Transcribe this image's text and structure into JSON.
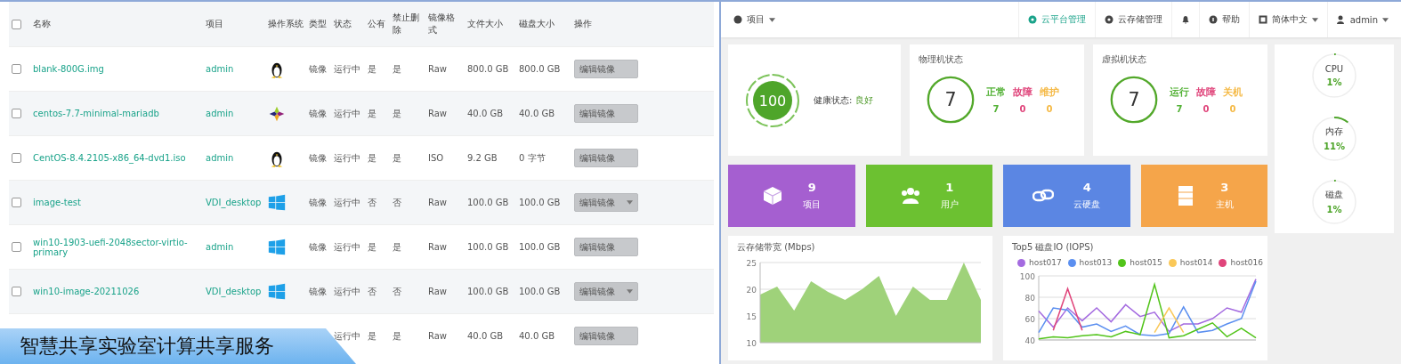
{
  "image_table": {
    "columns": [
      "名称",
      "项目",
      "操作系统",
      "类型",
      "状态",
      "公有",
      "禁止删除",
      "镜像格式",
      "文件大小",
      "磁盘大小",
      "操作"
    ],
    "header_checkbox": {
      "checked": false
    },
    "rows": [
      {
        "checked": false,
        "name": "blank-800G.img",
        "project": "admin",
        "kind": "linux",
        "type": "镜像",
        "status": "运行中",
        "public": "是",
        "protected": "是",
        "format": "Raw",
        "file_size": "800.0 GB",
        "disk_size": "800.0 GB",
        "action": "编辑镜像",
        "has_menu": false
      },
      {
        "checked": false,
        "name": "centos-7.7-minimal-mariadb",
        "project": "admin",
        "kind": "centos",
        "type": "镜像",
        "status": "运行中",
        "public": "是",
        "protected": "是",
        "format": "Raw",
        "file_size": "40.0 GB",
        "disk_size": "40.0 GB",
        "action": "编辑镜像",
        "has_menu": false
      },
      {
        "checked": false,
        "name": "CentOS-8.4.2105-x86_64-dvd1.iso",
        "project": "admin",
        "kind": "linux",
        "type": "镜像",
        "status": "运行中",
        "public": "是",
        "protected": "是",
        "format": "ISO",
        "file_size": "9.2 GB",
        "disk_size": "0 字节",
        "action": "编辑镜像",
        "has_menu": false
      },
      {
        "checked": false,
        "name": "image-test",
        "project": "VDI_desktop",
        "kind": "windows",
        "type": "镜像",
        "status": "运行中",
        "public": "否",
        "protected": "否",
        "format": "Raw",
        "file_size": "100.0 GB",
        "disk_size": "100.0 GB",
        "action": "编辑镜像",
        "has_menu": true
      },
      {
        "checked": false,
        "name": "win10-1903-uefi-2048sector-virtio-primary",
        "project": "admin",
        "kind": "windows",
        "type": "镜像",
        "status": "运行中",
        "public": "是",
        "protected": "是",
        "format": "Raw",
        "file_size": "100.0 GB",
        "disk_size": "100.0 GB",
        "action": "编辑镜像",
        "has_menu": false
      },
      {
        "checked": false,
        "name": "win10-image-20211026",
        "project": "VDI_desktop",
        "kind": "windows",
        "type": "镜像",
        "status": "运行中",
        "public": "否",
        "protected": "否",
        "format": "Raw",
        "file_size": "100.0 GB",
        "disk_size": "100.0 GB",
        "action": "编辑镜像",
        "has_menu": true
      },
      {
        "status": "运行中",
        "public": "是",
        "protected": "是",
        "format": "Raw",
        "file_size": "40.0 GB",
        "disk_size": "40.0 GB",
        "action": "编辑镜像",
        "has_menu": false
      }
    ]
  },
  "caption": "智慧共享实验室计算共享服务",
  "dashboard": {
    "topbar": {
      "project_menu": {
        "label": "项目",
        "has_menu": true
      },
      "items": [
        {
          "kind": "link",
          "label": "云平台管理",
          "selected": true,
          "has_menu": false
        },
        {
          "kind": "link",
          "label": "云存储管理",
          "selected": false,
          "has_menu": false
        },
        {
          "kind": "bell",
          "selected": false,
          "has_menu": false
        },
        {
          "kind": "help",
          "label": "帮助",
          "selected": false,
          "has_menu": false
        },
        {
          "kind": "lang",
          "label": "简体中文",
          "selected": false,
          "has_menu": true
        },
        {
          "kind": "user",
          "label": "admin",
          "selected": false,
          "has_menu": true
        }
      ]
    },
    "health": {
      "score": "100",
      "label": "健康状态:",
      "value": "良好"
    },
    "status_cards": [
      {
        "title": "物理机状态",
        "total": "7",
        "stats": [
          {
            "label": "正常",
            "value": "7",
            "color": "#52b135"
          },
          {
            "label": "故障",
            "value": "0",
            "color": "#e0457b"
          },
          {
            "label": "维护",
            "value": "0",
            "color": "#f5b945"
          }
        ]
      },
      {
        "title": "虚拟机状态",
        "total": "7",
        "stats": [
          {
            "label": "运行",
            "value": "7",
            "color": "#52b135"
          },
          {
            "label": "故障",
            "value": "0",
            "color": "#e0457b"
          },
          {
            "label": "关机",
            "value": "0",
            "color": "#f5b945"
          }
        ]
      }
    ],
    "tiles": [
      {
        "kind": "project",
        "value": "9",
        "label": "项目",
        "color": "#a55fd0"
      },
      {
        "kind": "user",
        "value": "1",
        "label": "用户",
        "color": "#6cc131"
      },
      {
        "kind": "disk",
        "value": "4",
        "label": "云硬盘",
        "color": "#5b86e3"
      },
      {
        "kind": "host",
        "value": "3",
        "label": "主机",
        "color": "#f5a54a"
      }
    ],
    "resources": [
      {
        "label": "CPU",
        "value": "1%",
        "level": 0.01
      },
      {
        "label": "内存",
        "value": "11%",
        "level": 0.11
      },
      {
        "label": "磁盘",
        "value": "1%",
        "level": 0.01
      }
    ],
    "bandwidth": {
      "chart_data": {
        "type": "area",
        "title": "云存储带宽 (Mbps)",
        "grid": true,
        "series": [
          {
            "color": "#9fd27a",
            "values": [
              19,
              20.5,
              16,
              21.5,
              19.5,
              18,
              20,
              22.5,
              15,
              20.5,
              18,
              18,
              25,
              18
            ]
          }
        ],
        "ylim": [
          10,
          25
        ],
        "yticks": [
          10,
          15,
          20,
          25
        ]
      }
    },
    "iops": {
      "chart_data": {
        "type": "line",
        "title": "Top5 磁盘IO (IOPS)",
        "grid": true,
        "series": [
          {
            "name": "host017",
            "color": "#a46be0",
            "values": [
              67,
              52,
              70,
              58,
              70,
              57,
              73,
              62,
              66,
              48,
              55,
              55,
              60,
              70,
              66,
              97
            ]
          },
          {
            "name": "host013",
            "color": "#5b8ff0",
            "values": [
              47,
              70,
              68,
              52,
              55,
              48,
              53,
              45,
              44,
              46,
              71,
              47,
              49,
              55,
              60,
              95
            ]
          },
          {
            "name": "host015",
            "color": "#52c41a",
            "values": [
              41,
              43,
              42,
              44,
              45,
              43,
              48,
              45,
              92,
              42,
              44,
              50,
              56,
              43,
              51,
              42
            ]
          },
          {
            "name": "host014",
            "color": "#fac858",
            "values": [
              null,
              null,
              null,
              null,
              null,
              null,
              null,
              null,
              47,
              70,
              47,
              null,
              null,
              null,
              null,
              null
            ]
          },
          {
            "name": "host016",
            "color": "#e0457b",
            "values": [
              null,
              49,
              88,
              49,
              null,
              null,
              null,
              null,
              null,
              null,
              null,
              null,
              null,
              null,
              null,
              null
            ]
          }
        ],
        "ylim": [
          40,
          100
        ],
        "yticks": [
          40,
          60,
          80,
          100
        ]
      }
    }
  }
}
